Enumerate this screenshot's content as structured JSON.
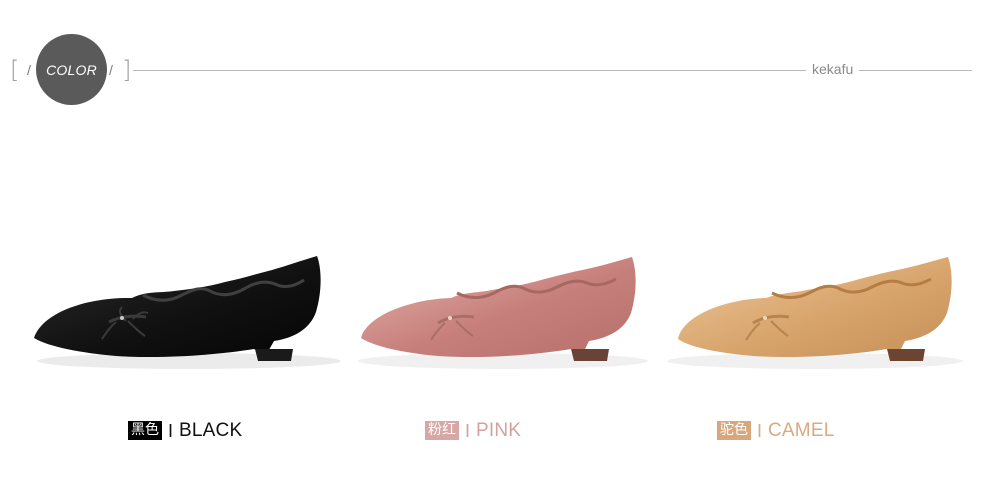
{
  "header": {
    "badge_label": "COLOR",
    "brand": "kekafu",
    "left_bracket": "[",
    "right_bracket": "]",
    "slash_left": "/",
    "slash_right": "/"
  },
  "products": [
    {
      "chinese": "黑色",
      "separator": "I",
      "english": "BLACK",
      "chip_color": "#000000",
      "text_color": "#111111",
      "shoe_fill": "#111111",
      "shoe_shade": "#2b2b2b",
      "heel_color": "#111111",
      "shoe_icon": "black-ballet-flat"
    },
    {
      "chinese": "粉红",
      "separator": "I",
      "english": "PINK",
      "chip_color": "#d7a7a5",
      "text_color": "#d1a2a0",
      "shoe_fill": "#c77f7b",
      "shoe_shade": "#e4b3ad",
      "heel_color": "#6a4338",
      "shoe_icon": "pink-ballet-flat"
    },
    {
      "chinese": "驼色",
      "separator": "I",
      "english": "CAMEL",
      "chip_color": "#d8a77b",
      "text_color": "#d9aa80",
      "shoe_fill": "#d8a56d",
      "shoe_shade": "#efc99f",
      "heel_color": "#6b4531",
      "shoe_icon": "camel-ballet-flat"
    }
  ]
}
